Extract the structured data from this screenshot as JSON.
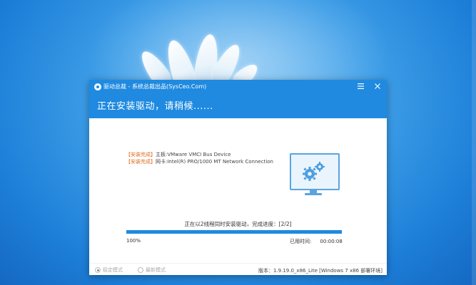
{
  "window": {
    "title": "驱动总裁 - 系统总裁出品(SysCeo.Com)",
    "menu_icon": "menu-icon",
    "close_icon": "close-icon"
  },
  "header": {
    "status": "正在安装驱动，请稍候......"
  },
  "log": [
    {
      "tag": "【安装完成】",
      "text": "主板:VMware VMCI Bus Device"
    },
    {
      "tag": "【安装完成】",
      "text": "网卡:Intel(R) PRO/1000 MT Network Connection"
    }
  ],
  "progress": {
    "caption": "正在以2线程同时安装驱动，完成进度：[2/2]",
    "percent_label": "100%",
    "percent_value": 1.0,
    "elapsed_label": "已用时间:",
    "elapsed_time": "00:00:08"
  },
  "footer": {
    "mode_stable": "稳定模式",
    "mode_fast": "最新模式",
    "selected_mode": "稳定模式",
    "version": "版本：1.9.19.0_x86_Lite [Windows 7 x86 部署环境]"
  },
  "colors": {
    "accent": "#1f8ae0",
    "tag": "#e06a1d",
    "desktop": "#3f9fe8"
  }
}
